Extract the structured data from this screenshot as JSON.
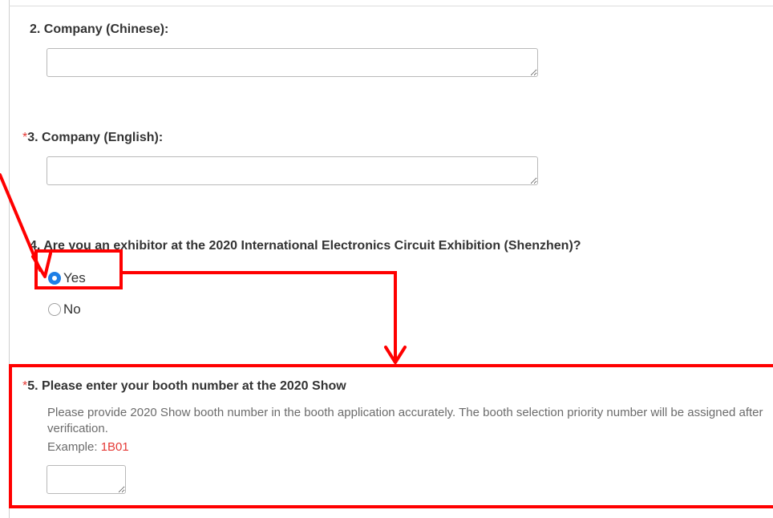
{
  "q2": {
    "number_label": "2.",
    "title": "Company (Chinese):",
    "value": ""
  },
  "q3": {
    "required_mark": "*",
    "number_label": "3.",
    "title": "Company (English):",
    "value": ""
  },
  "q4": {
    "number_label": "4.",
    "title": "Are you an exhibitor at the 2020 International Electronics Circuit Exhibition (Shenzhen)?",
    "options": [
      {
        "label": "Yes",
        "selected": true
      },
      {
        "label": "No",
        "selected": false
      }
    ]
  },
  "q5": {
    "required_mark": "*",
    "number_label": "5.",
    "title": "Please enter your booth number at the 2020 Show",
    "description": "Please provide 2020 Show booth number in the booth application accurately. The booth selection priority number will be assigned after verification.",
    "example_label": "Example:",
    "example_value": "1B01",
    "value": ""
  },
  "colors": {
    "annotation_red": "#ff0000",
    "required_red": "#e53935",
    "radio_blue": "#1e7fe6"
  }
}
